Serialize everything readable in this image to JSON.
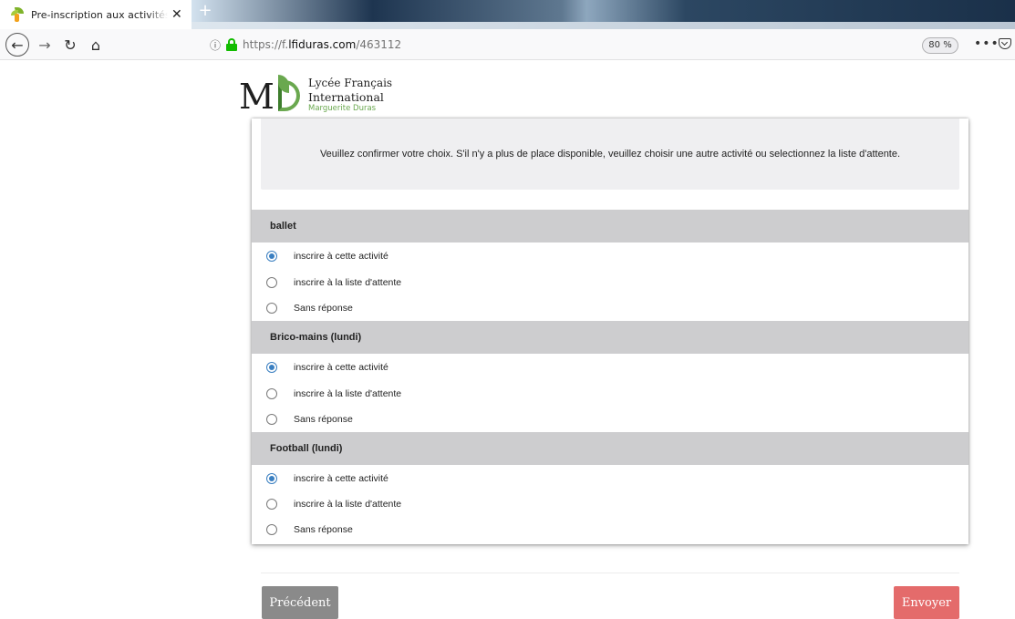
{
  "browser": {
    "tab_title": "Pre-inscription aux activités pé",
    "url_host_prefix": "https://f.",
    "url_host_bold": "lfiduras.com",
    "url_path": "/463112",
    "zoom": "80 %"
  },
  "logo": {
    "line1": "Lycée Français",
    "line2": "International",
    "line3": "Marguerite Duras",
    "letters": "M"
  },
  "notice": "Veuillez confirmer votre choix. S'il n'y a plus de place disponible, veuillez choisir une autre activité ou selectionnez la liste d'attente.",
  "sections": [
    {
      "title": "ballet",
      "options": [
        "inscrire à cette activité",
        "inscrire à la liste d'attente",
        "Sans réponse"
      ],
      "selected": 0
    },
    {
      "title": "Brico-mains (lundi)",
      "options": [
        "inscrire à cette activité",
        "inscrire à la liste d'attente",
        "Sans réponse"
      ],
      "selected": 0
    },
    {
      "title": "Football (lundi)",
      "options": [
        "inscrire à cette activité",
        "inscrire à la liste d'attente",
        "Sans réponse"
      ],
      "selected": 0
    }
  ],
  "buttons": {
    "previous": "Précédent",
    "send": "Envoyer"
  },
  "colors": {
    "accent_radio": "#3a7fc1",
    "send_button": "#e46b6b",
    "previous_button": "#8a8a8a",
    "section_header": "#cdcdcf",
    "brand_green": "#6aa84f"
  }
}
